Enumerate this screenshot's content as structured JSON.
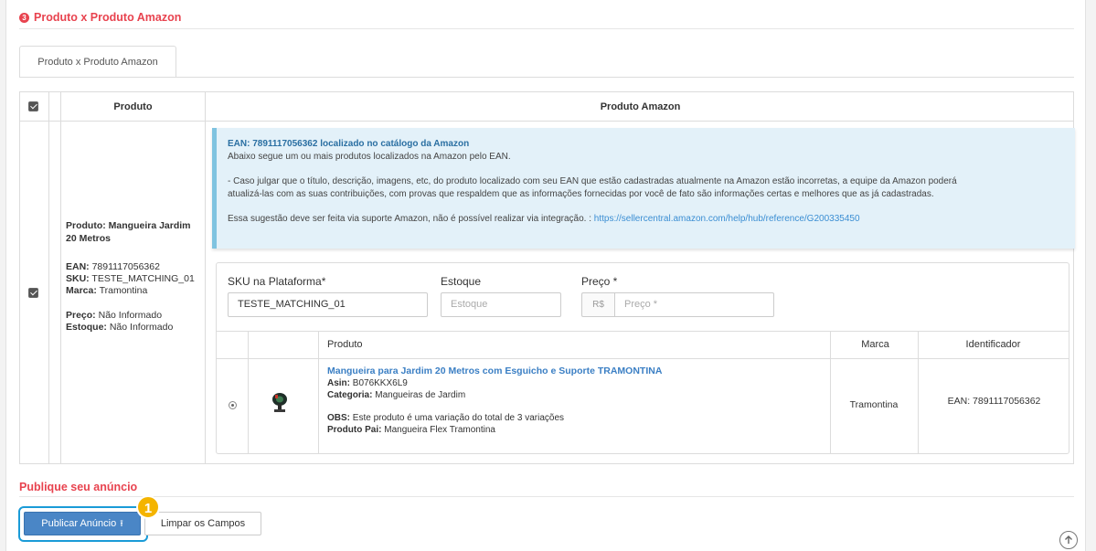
{
  "section": {
    "step": "3",
    "title": "Produto x Produto Amazon"
  },
  "tabs": [
    {
      "label": "Produto x Produto Amazon",
      "active": true
    }
  ],
  "table": {
    "headers": {
      "product": "Produto",
      "amazon": "Produto Amazon"
    },
    "row_checked": true,
    "product": {
      "title": "Produto: Mangueira Jardim 20 Metros",
      "ean_label": "EAN:",
      "ean": "7891117056362",
      "sku_label": "SKU:",
      "sku": "TESTE_MATCHING_01",
      "brand_label": "Marca:",
      "brand": "Tramontina",
      "price_label": "Preço:",
      "price": "Não Informado",
      "stock_label": "Estoque:",
      "stock": "Não Informado"
    }
  },
  "alert": {
    "heading": "EAN: 7891117056362 localizado no catálogo da Amazon",
    "line1": "Abaixo segue um ou mais produtos localizados na Amazon pelo EAN.",
    "line2": "- Caso julgar que o título, descrição, imagens, etc, do produto localizado com seu EAN que estão cadastradas atualmente na Amazon estão incorretas, a equipe da Amazon poderá",
    "line3": "atualizá-las com as suas contribuições, com provas que respaldem que as informações fornecidas por você de fato são informações certas e melhores que as já cadastradas.",
    "line4_text": "Essa sugestão deve ser feita via suporte Amazon, não é possível realizar via integração. : ",
    "line4_link": "https://sellercentral.amazon.com/help/hub/reference/G200335450"
  },
  "form": {
    "sku_label": "SKU na Plataforma*",
    "sku_value": "TESTE_MATCHING_01",
    "stock_label": "Estoque",
    "stock_placeholder": "Estoque",
    "price_label": "Preço *",
    "currency": "R$",
    "price_placeholder": "Preço *"
  },
  "amazon_table": {
    "headers": {
      "product": "Produto",
      "brand": "Marca",
      "identifier": "Identificador"
    },
    "item": {
      "selected": true,
      "name": "Mangueira para Jardim 20 Metros com Esguicho e Suporte TRAMONTINA",
      "asin_label": "Asin:",
      "asin": "B076KKX6L9",
      "category_label": "Categoria:",
      "category": "Mangueiras de Jardim",
      "obs_label": "OBS:",
      "obs": "Este produto é uma variação do total de 3 variações",
      "parent_label": "Produto Pai:",
      "parent": "Mangueira Flex Tramontina",
      "brand": "Tramontina",
      "identifier": "EAN: 7891117056362"
    }
  },
  "publish": {
    "title": "Publique seu anúncio",
    "publish_button": "Publicar Anúncio",
    "clear_button": "Limpar os Campos",
    "badge": "1"
  },
  "colors": {
    "accent_red": "#e8434f",
    "primary_blue": "#4a86c6",
    "highlight": "#1a9bd7",
    "badge": "#f4b400",
    "alert_bg": "#e3f1f9"
  }
}
